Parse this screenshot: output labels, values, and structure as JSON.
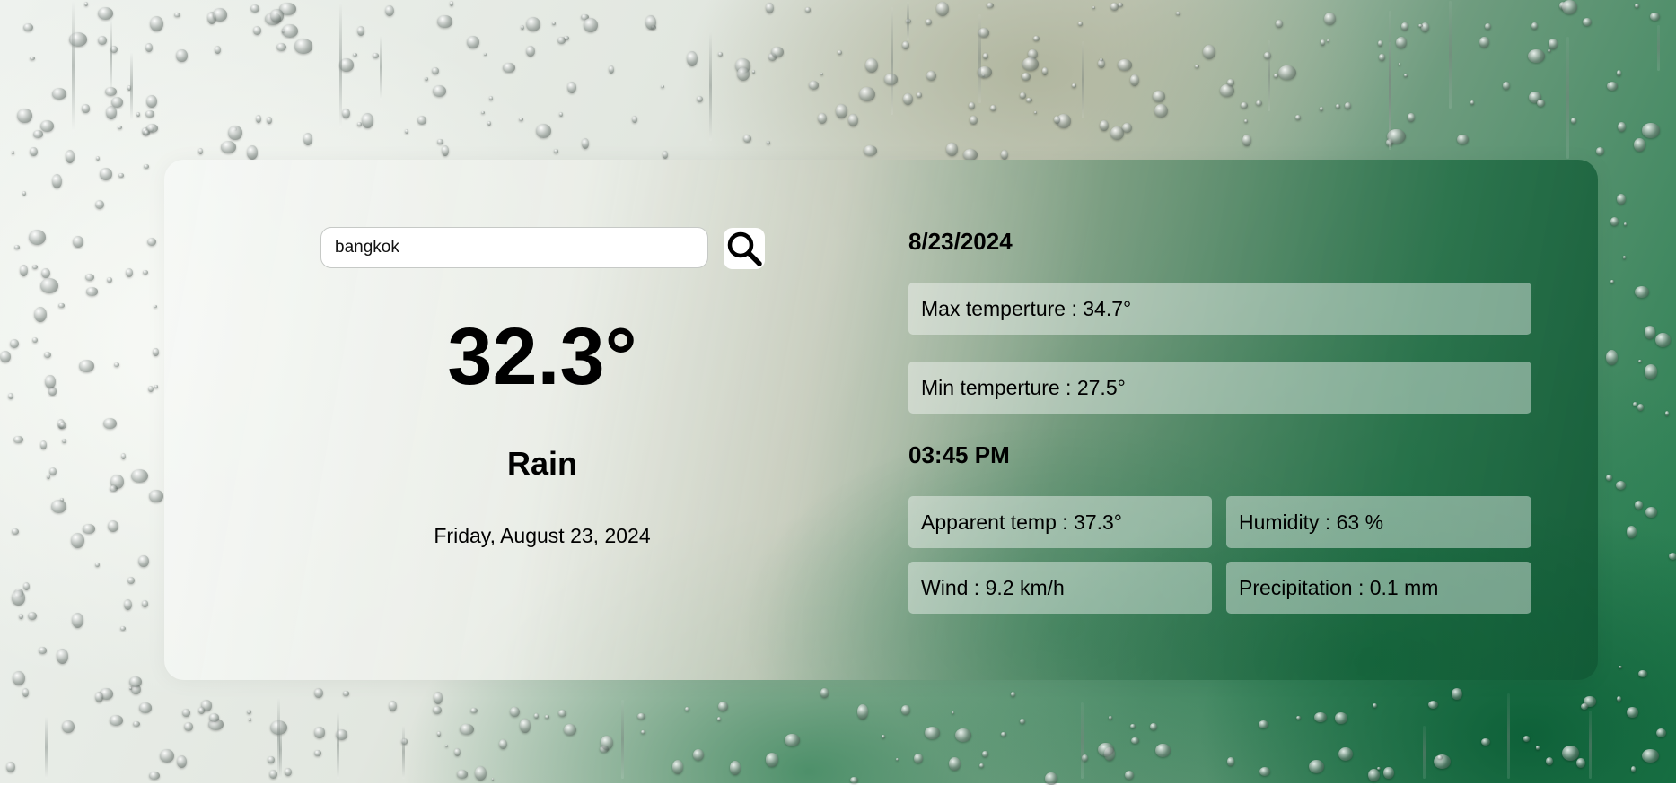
{
  "search": {
    "value": "bangkok",
    "button_icon": "search-icon"
  },
  "current": {
    "temperature": "32.3°",
    "condition": "Rain",
    "full_date": "Friday, August 23, 2024"
  },
  "details": {
    "date": "8/23/2024",
    "time": "03:45 PM",
    "max_temp": {
      "label": "Max temperture",
      "value": "34.7°"
    },
    "min_temp": {
      "label": "Min temperture",
      "value": "27.5°"
    },
    "apparent_temp": {
      "label": "Apparent temp",
      "value": "37.3°"
    },
    "humidity": {
      "label": "Humidity",
      "value": "63 %"
    },
    "wind": {
      "label": "Wind",
      "value": "9.2 km/h"
    },
    "precipitation": {
      "label": "Precipitation",
      "value": "0.1 mm"
    }
  },
  "colors": {
    "card_tint": "#ffffff",
    "accent_green": "#1e7a4a",
    "text": "#000000"
  }
}
